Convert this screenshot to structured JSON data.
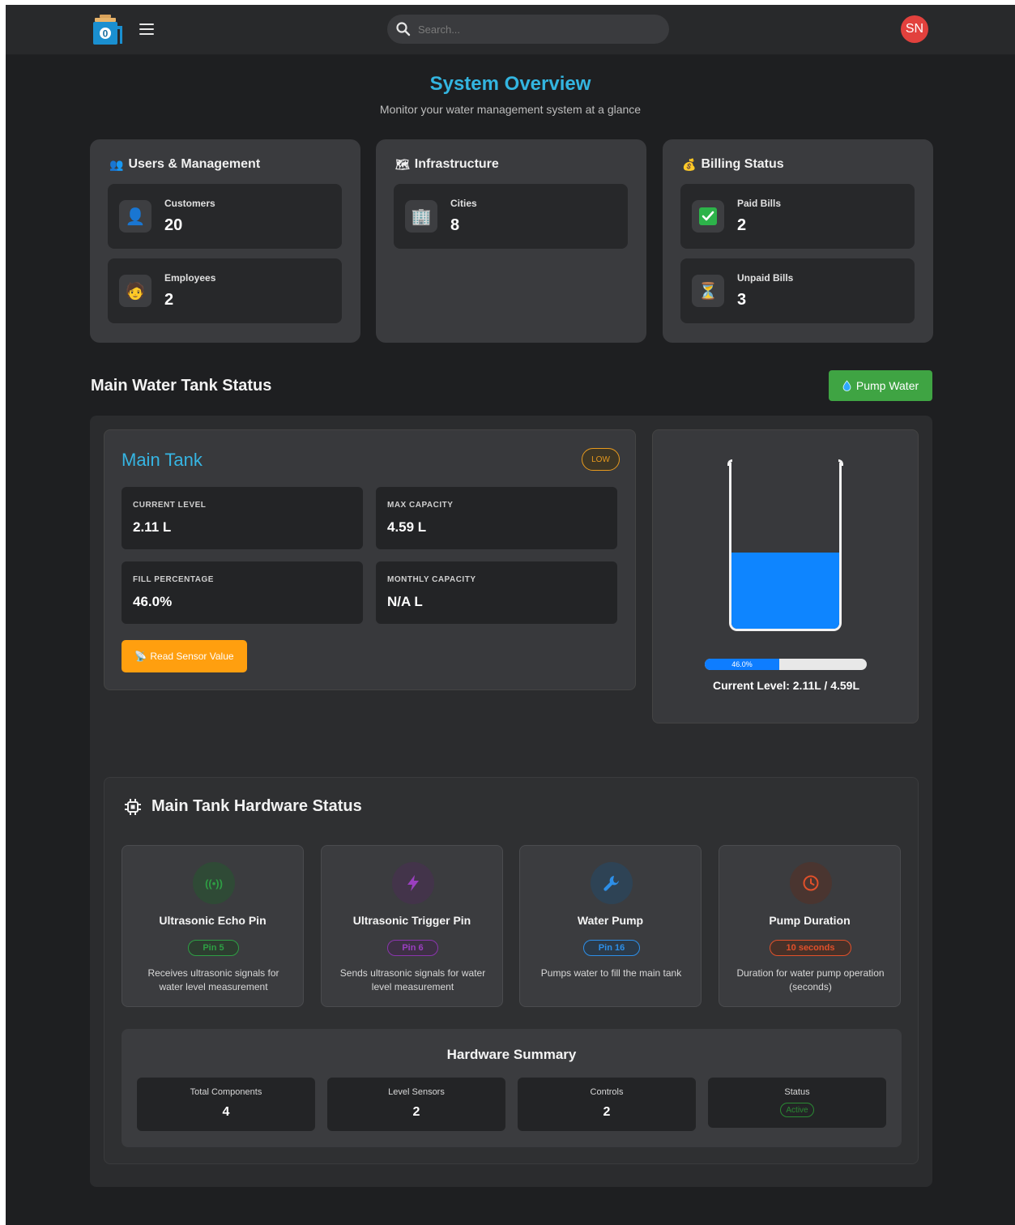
{
  "topbar": {
    "search_placeholder": "Search...",
    "avatar_initials": "SN",
    "icons": [
      "water-tank-logo-icon",
      "hamburger-menu-icon",
      "search-icon"
    ]
  },
  "page": {
    "title": "System Overview",
    "subtitle": "Monitor your water management system at a glance"
  },
  "groups": {
    "users": {
      "title": "Users & Management",
      "icon": "users-icon",
      "items": [
        {
          "label": "Customers",
          "value": "20",
          "icon": "customer-icon"
        },
        {
          "label": "Employees",
          "value": "2",
          "icon": "employee-icon"
        }
      ]
    },
    "infrastructure": {
      "title": "Infrastructure",
      "icon": "infrastructure-icon",
      "items": [
        {
          "label": "Cities",
          "value": "8",
          "icon": "city-building-icon"
        }
      ]
    },
    "billing": {
      "title": "Billing Status",
      "icon": "money-bag-icon",
      "items": [
        {
          "label": "Paid Bills",
          "value": "2",
          "icon": "check-icon"
        },
        {
          "label": "Unpaid Bills",
          "value": "3",
          "icon": "hourglass-icon"
        }
      ]
    }
  },
  "tank_section": {
    "title": "Main Water Tank Status",
    "pump_button": "Pump Water"
  },
  "main_tank": {
    "name": "Main Tank",
    "status_badge": "LOW",
    "metrics": [
      {
        "label": "CURRENT LEVEL",
        "value": "2.11 L"
      },
      {
        "label": "MAX CAPACITY",
        "value": "4.59 L"
      },
      {
        "label": "FILL PERCENTAGE",
        "value": "46.0%"
      },
      {
        "label": "MONTHLY CAPACITY",
        "value": "N/A L"
      }
    ],
    "read_button": "Read Sensor Value",
    "fill_percent": 46.0,
    "progress_label": "46.0%",
    "current_level_text": "Current Level: 2.11L / 4.59L"
  },
  "hardware": {
    "title": "Main Tank Hardware Status",
    "components": [
      {
        "name": "Ultrasonic Echo Pin",
        "pin": "Pin 5",
        "desc": "Receives ultrasonic signals for water level measurement",
        "icon": "signal-icon",
        "color": "#2e9e44"
      },
      {
        "name": "Ultrasonic Trigger Pin",
        "pin": "Pin 6",
        "desc": "Sends ultrasonic signals for water level measurement",
        "icon": "lightning-icon",
        "color": "#9b3fc0"
      },
      {
        "name": "Water Pump",
        "pin": "Pin 16",
        "desc": "Pumps water to fill the main tank",
        "icon": "wrench-icon",
        "color": "#2d8fe8"
      },
      {
        "name": "Pump Duration",
        "pin": "10 seconds",
        "desc": "Duration for water pump operation (seconds)",
        "icon": "clock-icon",
        "color": "#e0502a"
      }
    ],
    "summary": {
      "title": "Hardware Summary",
      "items": [
        {
          "label": "Total Components",
          "value": "4"
        },
        {
          "label": "Level Sensors",
          "value": "2"
        },
        {
          "label": "Controls",
          "value": "2"
        },
        {
          "label": "Status",
          "value": "Active"
        }
      ]
    }
  }
}
